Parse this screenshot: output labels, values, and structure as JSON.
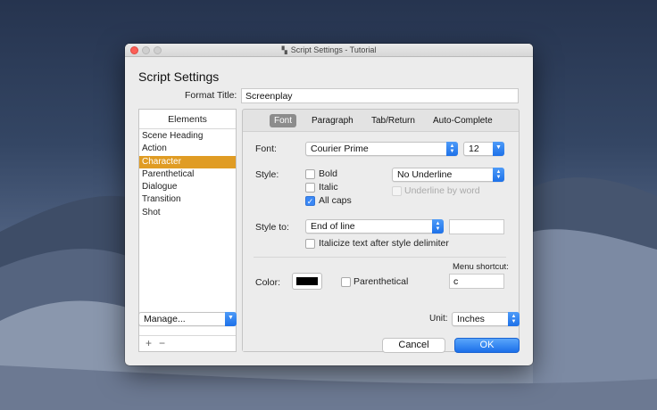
{
  "window": {
    "title": "Script Settings - Tutorial",
    "heading": "Script Settings"
  },
  "format_title": {
    "label": "Format Title:",
    "value": "Screenplay"
  },
  "elements": {
    "header": "Elements",
    "items": [
      {
        "label": "Scene Heading",
        "selected": false
      },
      {
        "label": "Action",
        "selected": false
      },
      {
        "label": "Character",
        "selected": true
      },
      {
        "label": "Parenthetical",
        "selected": false
      },
      {
        "label": "Dialogue",
        "selected": false
      },
      {
        "label": "Transition",
        "selected": false
      },
      {
        "label": "Shot",
        "selected": false
      }
    ],
    "add_symbol": "+",
    "remove_symbol": "−",
    "manage_label": "Manage..."
  },
  "tabs": [
    {
      "label": "Font",
      "active": true
    },
    {
      "label": "Paragraph",
      "active": false
    },
    {
      "label": "Tab/Return",
      "active": false
    },
    {
      "label": "Auto-Complete",
      "active": false
    }
  ],
  "font": {
    "label": "Font:",
    "family": "Courier Prime",
    "size": "12"
  },
  "style": {
    "label": "Style:",
    "bold_label": "Bold",
    "bold_checked": false,
    "italic_label": "Italic",
    "italic_checked": false,
    "allcaps_label": "All caps",
    "allcaps_checked": true,
    "underline_value": "No Underline",
    "underline_by_word_label": "Underline by word",
    "underline_by_word_checked": false
  },
  "style_to": {
    "label": "Style to:",
    "value": "End of line",
    "delimiter_value": "",
    "italicize_label": "Italicize text after style delimiter",
    "italicize_checked": false
  },
  "color": {
    "label": "Color:",
    "swatch": "#000000",
    "parenthetical_label": "Parenthetical",
    "parenthetical_checked": false
  },
  "menu_shortcut": {
    "label": "Menu shortcut:",
    "value": "c"
  },
  "unit": {
    "label": "Unit:",
    "value": "Inches"
  },
  "buttons": {
    "cancel": "Cancel",
    "ok": "OK"
  },
  "colors": {
    "selection": "#e09c24",
    "accent": "#1d71e9",
    "close": "#fc5f57"
  }
}
